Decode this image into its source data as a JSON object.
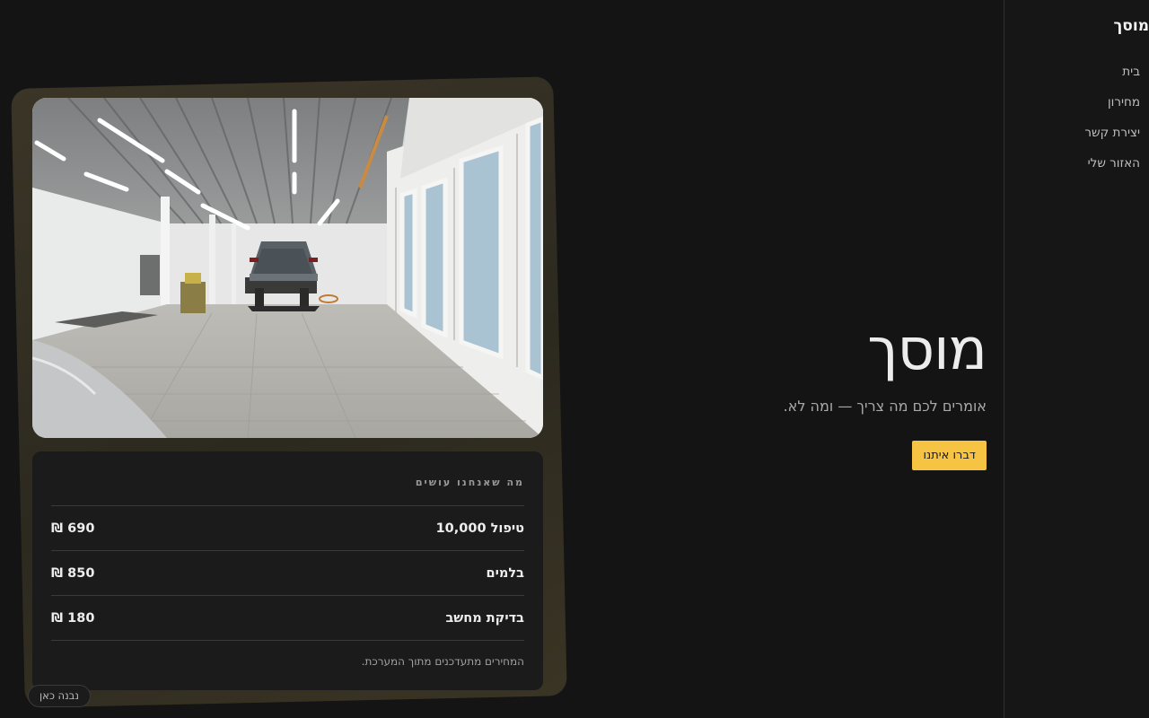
{
  "sidebar": {
    "brand": "מוסך",
    "items": [
      {
        "label": "בית"
      },
      {
        "label": "מחירון"
      },
      {
        "label": "יצירת קשר"
      },
      {
        "label": "האזור שלי"
      }
    ]
  },
  "hero": {
    "title": "מוסך",
    "subtitle": "אומרים לכם מה צריך — ומה לא.",
    "cta_label": "דברו איתנו"
  },
  "pricing": {
    "heading": "מה שאנחנו עושים",
    "rows": [
      {
        "service": "טיפול 10,000",
        "price": "690 ₪"
      },
      {
        "service": "בלמים",
        "price": "850 ₪"
      },
      {
        "service": "בדיקת מחשב",
        "price": "180 ₪"
      }
    ],
    "note": "המחירים מתעדכנים מתוך המערכת."
  },
  "badge": "נבנה כאן",
  "colors": {
    "background": "#141414",
    "accent": "#f6c343",
    "card_frame": "#332e22"
  }
}
